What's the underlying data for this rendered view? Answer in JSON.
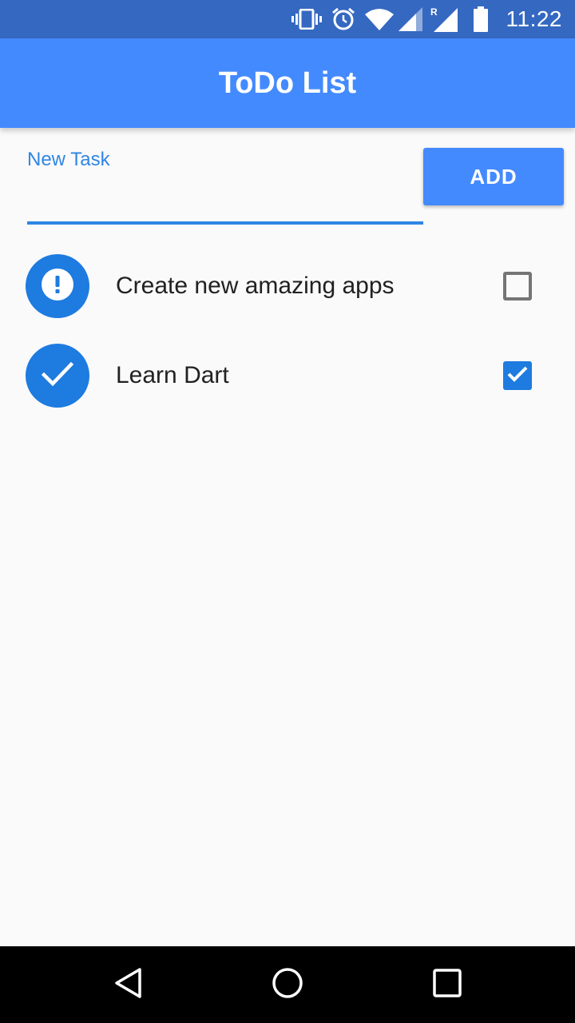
{
  "status_bar": {
    "time": "11:22",
    "icons": [
      "vibrate-icon",
      "alarm-icon",
      "wifi-icon",
      "signal-icon",
      "roaming-signal-icon",
      "battery-icon"
    ]
  },
  "app_bar": {
    "title": "ToDo List"
  },
  "new_task": {
    "label": "New Task",
    "value": "",
    "add_label": "ADD"
  },
  "tasks": [
    {
      "text": "Create new amazing apps",
      "done": false,
      "icon": "exclamation-icon"
    },
    {
      "text": "Learn Dart",
      "done": true,
      "icon": "check-icon"
    }
  ],
  "colors": {
    "status_bar": "#3568c0",
    "primary": "#448aff",
    "accent": "#1e7be0",
    "background": "#fafafa"
  },
  "nav_bar": {
    "icons": [
      "back-icon",
      "home-icon",
      "recents-icon"
    ]
  }
}
